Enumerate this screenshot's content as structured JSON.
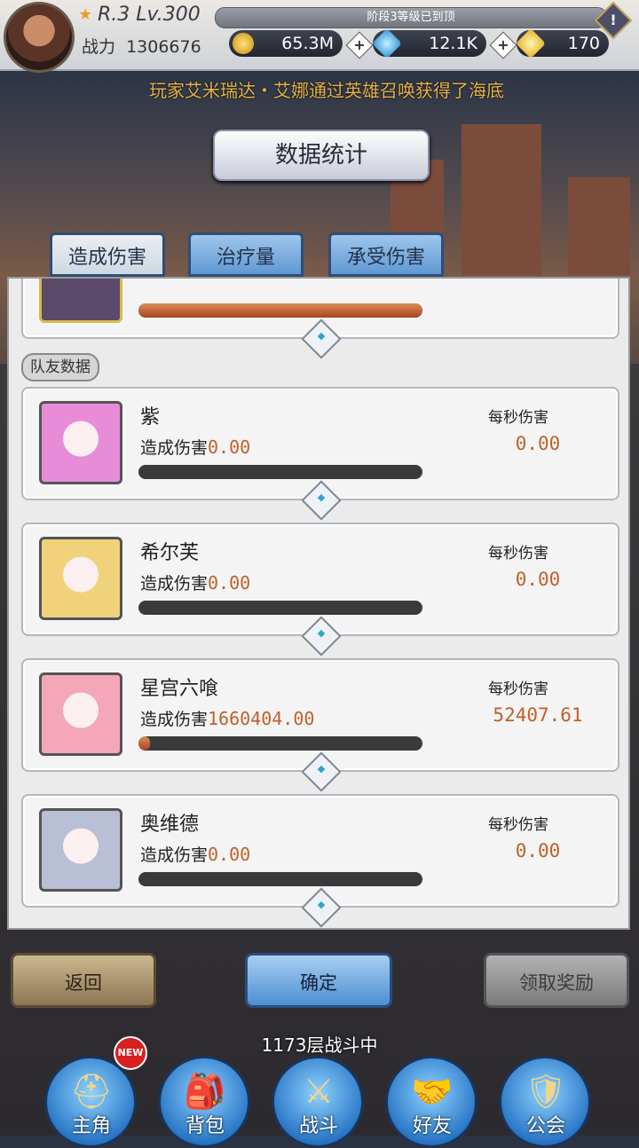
{
  "header": {
    "rank_level": "R.3 Lv.300",
    "power_label": "战力",
    "power_value": "1306676",
    "stage_notice": "阶段3等级已到顶",
    "alert_symbol": "!",
    "resources": [
      {
        "icon": "gold-coin-icon",
        "value": "65.3M"
      },
      {
        "icon": "blue-crystal-icon",
        "value": "12.1K"
      },
      {
        "icon": "gold-gem-icon",
        "value": "170"
      }
    ],
    "plus_symbol": "+"
  },
  "broadcast": "玩家艾米瑞达・艾娜通过英雄召唤获得了海底",
  "title": "数据统计",
  "tabs": [
    {
      "label": "造成伤害",
      "state": "active"
    },
    {
      "label": "治疗量",
      "state": "inactive"
    },
    {
      "label": "承受伤害",
      "state": "inactive"
    }
  ],
  "section_label": "队友数据",
  "heroes": [
    {
      "name": "紫",
      "dmg_label": "造成伤害",
      "dmg_value": "0.00",
      "dps_label": "每秒伤害",
      "dps_value": "0.00",
      "bar_fraction": 0.0,
      "portrait_color": "#e98cd7"
    },
    {
      "name": "希尔芙",
      "dmg_label": "造成伤害",
      "dmg_value": "0.00",
      "dps_label": "每秒伤害",
      "dps_value": "0.00",
      "bar_fraction": 0.0,
      "portrait_color": "#f0d27a"
    },
    {
      "name": "星宫六喰",
      "dmg_label": "造成伤害",
      "dmg_value": "1660404.00",
      "dps_label": "每秒伤害",
      "dps_value": "52407.61",
      "bar_fraction": 0.04,
      "portrait_color": "#f4a7b9"
    },
    {
      "name": "奥维德",
      "dmg_label": "造成伤害",
      "dmg_value": "0.00",
      "dps_label": "每秒伤害",
      "dps_value": "0.00",
      "bar_fraction": 0.0,
      "portrait_color": "#b9bfd4"
    }
  ],
  "top_card_bar_fraction": 1.0,
  "buttons": {
    "back": "返回",
    "confirm": "确定",
    "reward": "领取奖励"
  },
  "floor_status": "1173层战斗中",
  "nav": [
    {
      "label": "主角",
      "icon": "helmet-icon",
      "badge": "NEW"
    },
    {
      "label": "背包",
      "icon": "backpack-icon"
    },
    {
      "label": "战斗",
      "icon": "crossed-swords-icon"
    },
    {
      "label": "好友",
      "icon": "handshake-icon"
    },
    {
      "label": "公会",
      "icon": "guild-crest-icon"
    }
  ]
}
